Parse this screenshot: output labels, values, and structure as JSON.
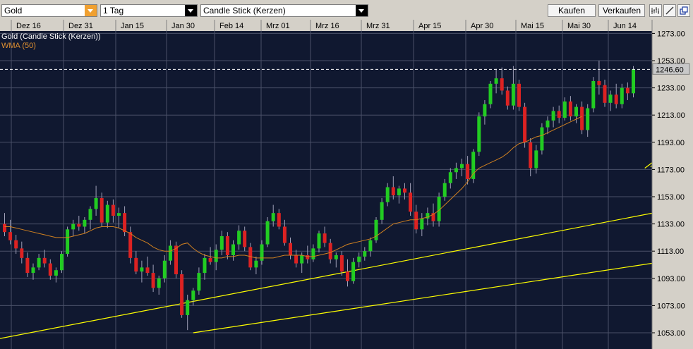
{
  "toolbar": {
    "symbol": "Gold",
    "interval": "1 Tag",
    "chart_type": "Candle Stick (Kerzen)",
    "buy_label": "Kaufen",
    "sell_label": "Verkaufen",
    "icons": [
      "bar-style-icon",
      "draw-line-icon",
      "popout-icon"
    ],
    "accent_color": "#f0a030"
  },
  "chart_data": {
    "type": "candlestick",
    "legend": [
      "Gold (Candle Stick (Kerzen))",
      "WMA (50)"
    ],
    "x_ticks": [
      "Dez 16",
      "Dez 31",
      "Jan 15",
      "Jan 30",
      "Feb 14",
      "Mrz 01",
      "Mrz 16",
      "Mrz 31",
      "Apr 15",
      "Apr 30",
      "Mai 15",
      "Mai 30",
      "Jun 14"
    ],
    "y_ticks": [
      1273.0,
      1253.0,
      1233.0,
      1213.0,
      1193.0,
      1173.0,
      1153.0,
      1133.0,
      1113.0,
      1093.0,
      1073.0,
      1053.0
    ],
    "ylim": [
      1047,
      1288
    ],
    "last_price_label": "1246.60",
    "last_price": 1246.6,
    "colors": {
      "background": "#101830",
      "grid": "#4a5068",
      "up": "#22cc22",
      "down": "#dd2222",
      "wma": "#d08020",
      "trend": "#ffff00"
    },
    "ohlc": [
      [
        1133,
        1141,
        1124,
        1127
      ],
      [
        1127,
        1136,
        1118,
        1121
      ],
      [
        1121,
        1125,
        1111,
        1115
      ],
      [
        1115,
        1120,
        1104,
        1108
      ],
      [
        1108,
        1112,
        1094,
        1097
      ],
      [
        1097,
        1104,
        1092,
        1101
      ],
      [
        1101,
        1111,
        1099,
        1108
      ],
      [
        1108,
        1114,
        1101,
        1104
      ],
      [
        1104,
        1107,
        1092,
        1095
      ],
      [
        1095,
        1101,
        1090,
        1099
      ],
      [
        1099,
        1113,
        1097,
        1111
      ],
      [
        1111,
        1131,
        1109,
        1129
      ],
      [
        1129,
        1136,
        1124,
        1133
      ],
      [
        1133,
        1139,
        1128,
        1131
      ],
      [
        1131,
        1138,
        1126,
        1136
      ],
      [
        1136,
        1146,
        1129,
        1144
      ],
      [
        1144,
        1161,
        1139,
        1152
      ],
      [
        1152,
        1156,
        1131,
        1134
      ],
      [
        1134,
        1150,
        1130,
        1147
      ],
      [
        1147,
        1151,
        1134,
        1139
      ],
      [
        1139,
        1145,
        1130,
        1141
      ],
      [
        1141,
        1146,
        1124,
        1127
      ],
      [
        1127,
        1131,
        1104,
        1108
      ],
      [
        1108,
        1113,
        1096,
        1098
      ],
      [
        1098,
        1106,
        1090,
        1101
      ],
      [
        1101,
        1109,
        1095,
        1097
      ],
      [
        1097,
        1103,
        1083,
        1086
      ],
      [
        1086,
        1095,
        1081,
        1093
      ],
      [
        1093,
        1110,
        1090,
        1106
      ],
      [
        1106,
        1121,
        1103,
        1117
      ],
      [
        1117,
        1120,
        1093,
        1096
      ],
      [
        1096,
        1099,
        1064,
        1066
      ],
      [
        1066,
        1081,
        1055,
        1077
      ],
      [
        1077,
        1086,
        1073,
        1084
      ],
      [
        1084,
        1101,
        1081,
        1097
      ],
      [
        1097,
        1111,
        1092,
        1108
      ],
      [
        1108,
        1116,
        1103,
        1105
      ],
      [
        1105,
        1118,
        1099,
        1114
      ],
      [
        1114,
        1128,
        1110,
        1124
      ],
      [
        1124,
        1127,
        1107,
        1110
      ],
      [
        1110,
        1121,
        1106,
        1118
      ],
      [
        1118,
        1132,
        1114,
        1128
      ],
      [
        1128,
        1131,
        1113,
        1116
      ],
      [
        1116,
        1119,
        1099,
        1101
      ],
      [
        1101,
        1109,
        1096,
        1106
      ],
      [
        1106,
        1121,
        1103,
        1118
      ],
      [
        1118,
        1138,
        1116,
        1135
      ],
      [
        1135,
        1147,
        1131,
        1141
      ],
      [
        1141,
        1144,
        1129,
        1131
      ],
      [
        1131,
        1136,
        1117,
        1119
      ],
      [
        1119,
        1123,
        1107,
        1110
      ],
      [
        1110,
        1114,
        1101,
        1104
      ],
      [
        1104,
        1112,
        1097,
        1110
      ],
      [
        1110,
        1117,
        1104,
        1107
      ],
      [
        1107,
        1118,
        1105,
        1115
      ],
      [
        1115,
        1128,
        1112,
        1126
      ],
      [
        1126,
        1131,
        1116,
        1119
      ],
      [
        1119,
        1122,
        1104,
        1107
      ],
      [
        1107,
        1112,
        1101,
        1110
      ],
      [
        1110,
        1113,
        1095,
        1098
      ],
      [
        1098,
        1107,
        1087,
        1091
      ],
      [
        1091,
        1108,
        1089,
        1105
      ],
      [
        1105,
        1112,
        1101,
        1109
      ],
      [
        1109,
        1116,
        1106,
        1113
      ],
      [
        1113,
        1123,
        1109,
        1121
      ],
      [
        1121,
        1138,
        1119,
        1136
      ],
      [
        1136,
        1152,
        1133,
        1149
      ],
      [
        1149,
        1163,
        1146,
        1160
      ],
      [
        1160,
        1168,
        1151,
        1154
      ],
      [
        1154,
        1161,
        1148,
        1159
      ],
      [
        1159,
        1163,
        1151,
        1156
      ],
      [
        1156,
        1163,
        1139,
        1142
      ],
      [
        1142,
        1147,
        1126,
        1129
      ],
      [
        1129,
        1141,
        1124,
        1137
      ],
      [
        1137,
        1145,
        1132,
        1141
      ],
      [
        1141,
        1148,
        1131,
        1135
      ],
      [
        1135,
        1156,
        1131,
        1153
      ],
      [
        1153,
        1166,
        1150,
        1163
      ],
      [
        1163,
        1174,
        1159,
        1171
      ],
      [
        1171,
        1178,
        1166,
        1174
      ],
      [
        1174,
        1181,
        1168,
        1177
      ],
      [
        1177,
        1183,
        1162,
        1166
      ],
      [
        1166,
        1188,
        1163,
        1186
      ],
      [
        1186,
        1215,
        1183,
        1212
      ],
      [
        1212,
        1224,
        1206,
        1221
      ],
      [
        1221,
        1238,
        1218,
        1236
      ],
      [
        1236,
        1247,
        1229,
        1240
      ],
      [
        1240,
        1248,
        1228,
        1231
      ],
      [
        1231,
        1234,
        1217,
        1220
      ],
      [
        1220,
        1249,
        1217,
        1236
      ],
      [
        1236,
        1239,
        1216,
        1219
      ],
      [
        1219,
        1222,
        1189,
        1193
      ],
      [
        1193,
        1196,
        1168,
        1174
      ],
      [
        1174,
        1191,
        1170,
        1187
      ],
      [
        1187,
        1207,
        1184,
        1204
      ],
      [
        1204,
        1212,
        1199,
        1209
      ],
      [
        1209,
        1219,
        1204,
        1216
      ],
      [
        1216,
        1220,
        1207,
        1211
      ],
      [
        1211,
        1226,
        1209,
        1223
      ],
      [
        1223,
        1227,
        1209,
        1212
      ],
      [
        1212,
        1221,
        1207,
        1219
      ],
      [
        1219,
        1223,
        1199,
        1202
      ],
      [
        1202,
        1221,
        1197,
        1218
      ],
      [
        1218,
        1241,
        1215,
        1238
      ],
      [
        1238,
        1253,
        1228,
        1235
      ],
      [
        1235,
        1239,
        1219,
        1222
      ],
      [
        1222,
        1231,
        1216,
        1228
      ],
      [
        1228,
        1236,
        1218,
        1221
      ],
      [
        1221,
        1236,
        1218,
        1233
      ],
      [
        1233,
        1237,
        1224,
        1229
      ],
      [
        1229,
        1249,
        1226,
        1246.6
      ]
    ],
    "wma": [
      1131,
      1131,
      1130,
      1129,
      1128,
      1127,
      1126,
      1125,
      1124,
      1123,
      1123,
      1123,
      1124,
      1125,
      1126,
      1128,
      1130,
      1131,
      1131,
      1131,
      1130,
      1128,
      1126,
      1123,
      1121,
      1119,
      1116,
      1114,
      1113,
      1113,
      1115,
      1118,
      1119,
      1115,
      1112,
      1110,
      1109,
      1108,
      1108,
      1109,
      1109,
      1110,
      1110,
      1109,
      1108,
      1108,
      1108,
      1108,
      1109,
      1110,
      1110,
      1110,
      1110,
      1109,
      1109,
      1110,
      1111,
      1112,
      1114,
      1116,
      1118,
      1119,
      1120,
      1121,
      1122,
      1124,
      1127,
      1130,
      1133,
      1134,
      1135,
      1136,
      1136,
      1137,
      1138,
      1140,
      1143,
      1147,
      1151,
      1155,
      1159,
      1164,
      1170,
      1174,
      1176,
      1178,
      1180,
      1182,
      1185,
      1189,
      1192,
      1193,
      1195,
      1197,
      1198,
      1200,
      1202,
      1204,
      1206,
      1208,
      1210,
      1212
    ],
    "trendlines": [
      {
        "x1": -3,
        "y1": 1047,
        "x2": 132,
        "y2": 1156
      },
      {
        "x1": 33,
        "y1": 1053,
        "x2": 132,
        "y2": 1116
      },
      {
        "x1": 112,
        "y1": 1174,
        "x2": 126,
        "y2": 1218
      },
      {
        "x1": 113,
        "y1": 1175,
        "x2": 131,
        "y2": 1228
      }
    ]
  }
}
